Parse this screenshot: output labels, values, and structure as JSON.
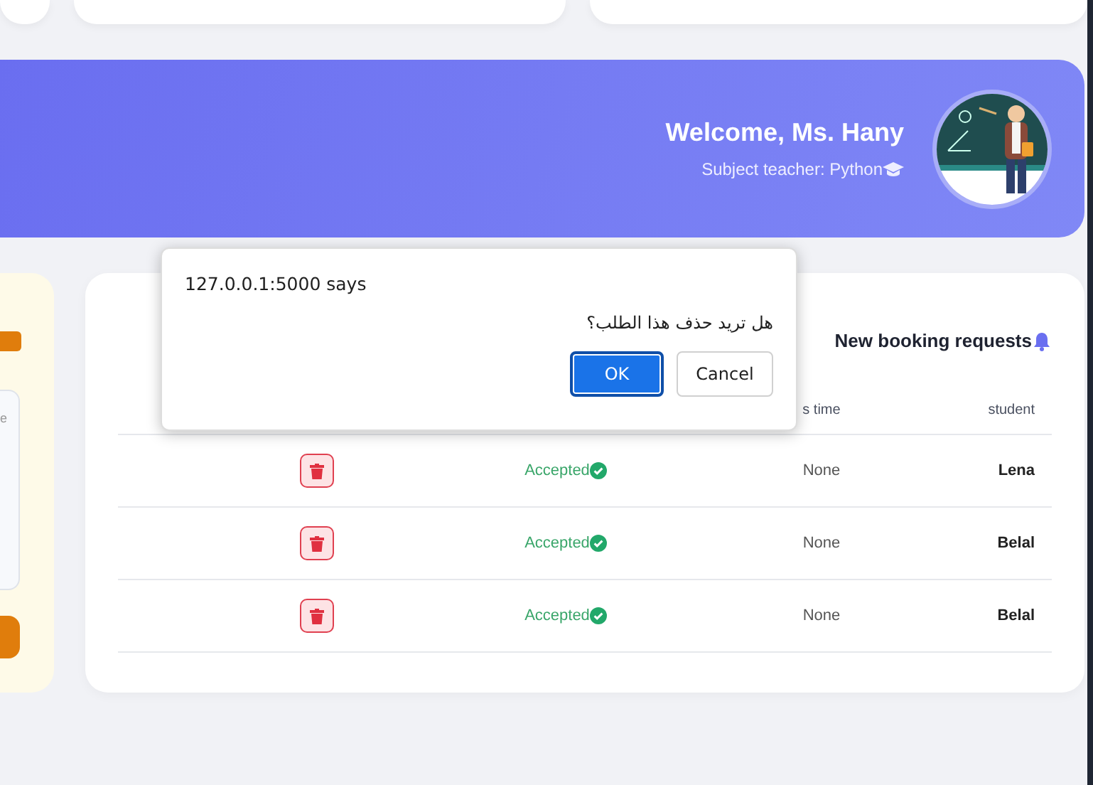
{
  "banner": {
    "title": "Welcome, Ms. Hany",
    "subtitle": "Subject teacher: Python"
  },
  "side_panel": {
    "placeholder": "e"
  },
  "bookings": {
    "title": "New booking requests",
    "columns": [
      "s time",
      "student"
    ],
    "rows": [
      {
        "student": "Lena",
        "time": "None",
        "status": "Accepted",
        "kind": "accepted"
      },
      {
        "student": "Belal",
        "time": "None",
        "status": "Accepted",
        "kind": "accepted"
      },
      {
        "student": "Belal",
        "time": "None",
        "status": "Accepted",
        "kind": "accepted"
      }
    ]
  },
  "dialog": {
    "title": "127.0.0.1:5000 says",
    "message": "هل تريد حذف هذا الطلب؟",
    "buttons": [
      {
        "label": "OK",
        "selected": true
      },
      {
        "label": "Cancel",
        "selected": false
      }
    ]
  }
}
